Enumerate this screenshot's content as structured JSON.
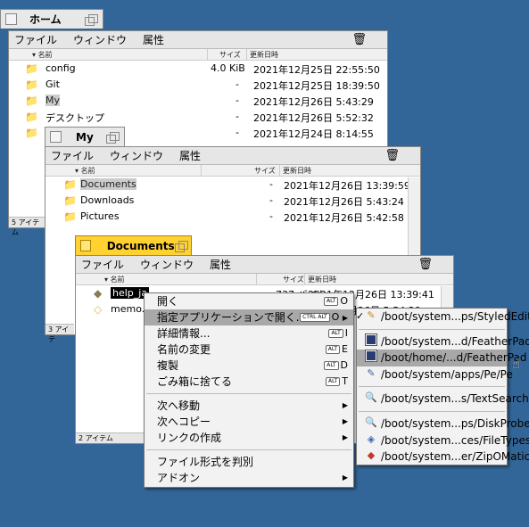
{
  "home_window": {
    "tab_title": "ホーム",
    "menu": [
      "ファイル",
      "ウィンドウ",
      "属性"
    ],
    "columns": {
      "name": "名前",
      "size": "サイズ",
      "modified": "更新日時"
    },
    "rows": [
      {
        "name": "config",
        "size": "4.0 KiB",
        "date": "2021年12月25日 22:55:50"
      },
      {
        "name": "Git",
        "size": "-",
        "date": "2021年12月25日 18:39:50"
      },
      {
        "name": "My",
        "size": "-",
        "date": "2021年12月26日 5:43:29"
      },
      {
        "name": "デスクトップ",
        "size": "-",
        "date": "2021年12月26日 5:52:32"
      },
      {
        "name": "",
        "size": "-",
        "date": "2021年12月24日 8:14:55"
      }
    ],
    "status": "5 アイテム"
  },
  "my_window": {
    "tab_title": "My",
    "menu": [
      "ファイル",
      "ウィンドウ",
      "属性"
    ],
    "columns": {
      "name": "名前",
      "size": "サイズ",
      "modified": "更新日時"
    },
    "rows": [
      {
        "name": "Documents",
        "size": "-",
        "date": "2021年12月26日 13:39:59"
      },
      {
        "name": "Downloads",
        "size": "-",
        "date": "2021年12月26日 5:43:24"
      },
      {
        "name": "Pictures",
        "size": "-",
        "date": "2021年12月26日 5:42:58"
      }
    ],
    "status": "3 アイテ"
  },
  "docs_window": {
    "tab_title": "Documents",
    "menu": [
      "ファイル",
      "ウィンドウ",
      "属性"
    ],
    "columns": {
      "name": "名前",
      "size": "サイズ",
      "modified": "更新日時"
    },
    "rows": [
      {
        "name": "help_ja",
        "size": "737 バイト",
        "date": "2021年12月26日 13:39:41"
      },
      {
        "name": "memo.t",
        "size": "",
        "date": "月26日 5:54:29"
      }
    ],
    "status": "2 アイテム"
  },
  "context_menu": {
    "items": [
      {
        "label": "開く",
        "mod": "ALT",
        "key": "O"
      },
      {
        "label": "指定アプリケーションで開く...",
        "mod": "CTRL ALT",
        "key": "O"
      },
      {
        "label": "詳細情報...",
        "mod": "ALT",
        "key": "I"
      },
      {
        "label": "名前の変更",
        "mod": "ALT",
        "key": "E"
      },
      {
        "label": "複製",
        "mod": "ALT",
        "key": "D"
      },
      {
        "label": "ごみ箱に捨てる",
        "mod": "ALT",
        "key": "T"
      },
      {
        "label": "次へ移動"
      },
      {
        "label": "次へコピー"
      },
      {
        "label": "リンクの作成"
      },
      {
        "label": "ファイル形式を判別"
      },
      {
        "label": "アドオン"
      }
    ]
  },
  "open_with_submenu": {
    "items": [
      {
        "label": "/boot/system...ps/StyledEdit",
        "icon": "styled-edit-icon"
      },
      {
        "label": "/boot/system...d/FeatherPad",
        "icon": "featherpad-icon"
      },
      {
        "label": "/boot/home/...d/FeatherPad",
        "icon": "featherpad-icon"
      },
      {
        "label": "/boot/system/apps/Pe/Pe",
        "icon": "pe-icon"
      },
      {
        "label": "/boot/system...s/TextSearch",
        "icon": "textsearch-icon"
      },
      {
        "label": "/boot/system...ps/DiskProbe",
        "icon": "diskprobe-icon"
      },
      {
        "label": "/boot/system...ces/FileTypes",
        "icon": "filetypes-icon"
      },
      {
        "label": "/boot/system...er/ZipOMatic",
        "icon": "zipomatic-icon"
      }
    ]
  },
  "colors": {
    "desktop": "#336698",
    "active_tab": "#ffd232",
    "highlight": "#a8a8a8"
  }
}
